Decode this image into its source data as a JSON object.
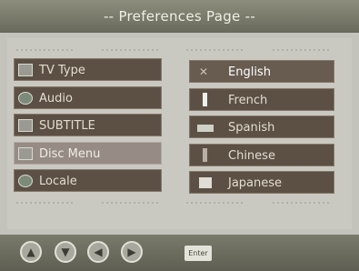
{
  "header": {
    "title": "-- Preferences Page --"
  },
  "left_menu": {
    "items": [
      {
        "label": "TV Type",
        "icon": "tv-icon"
      },
      {
        "label": "Audio",
        "icon": "speaker-icon"
      },
      {
        "label": "SUBTITLE",
        "icon": "subtitle-icon"
      },
      {
        "label": "Disc Menu",
        "icon": "disc-menu-icon"
      },
      {
        "label": "Locale",
        "icon": "globe-icon"
      }
    ],
    "selected": "Disc Menu"
  },
  "right_menu": {
    "items": [
      {
        "label": "English",
        "icon": "uk-flag-icon"
      },
      {
        "label": "French",
        "icon": "france-flag-icon"
      },
      {
        "label": "Spanish",
        "icon": "spain-flag-icon"
      },
      {
        "label": "Chinese",
        "icon": "china-flag-icon"
      },
      {
        "label": "Japanese",
        "icon": "japan-flag-icon"
      }
    ],
    "selected": "English"
  },
  "footer": {
    "nav_buttons": [
      "up-arrow-icon",
      "down-arrow-icon",
      "left-arrow-icon",
      "right-arrow-icon"
    ],
    "enter_label": "Enter"
  },
  "colors": {
    "title_bar": "#6a6a5c",
    "menu_item_bg": "#5c5045",
    "menu_selected_bg": "#968c85",
    "panel_bg": "#c9c9c1"
  }
}
